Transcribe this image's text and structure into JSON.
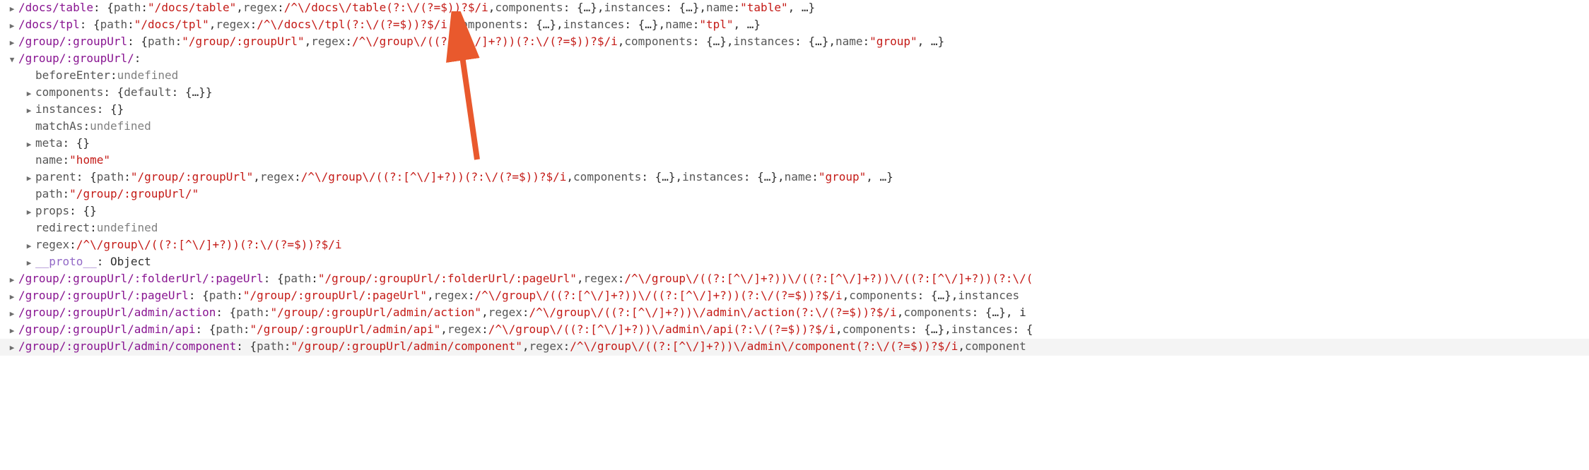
{
  "colors": {
    "key_purple": "#881491",
    "string_red": "#c41a16",
    "prop_grey": "#565656",
    "undefined_grey": "#808080",
    "proto_purple": "#9268c6"
  },
  "rows": [
    {
      "indent": 0,
      "expand": "closed",
      "key": "/docs/table",
      "keyClass": "k-path",
      "segs": [
        {
          "t": "punct",
          "v": ": {"
        },
        {
          "t": "k-prop",
          "v": "path"
        },
        {
          "t": "punct",
          "v": ": "
        },
        {
          "t": "str",
          "v": "\"/docs/table\""
        },
        {
          "t": "punct",
          "v": ", "
        },
        {
          "t": "k-prop",
          "v": "regex"
        },
        {
          "t": "punct",
          "v": ": "
        },
        {
          "t": "regex",
          "v": "/^\\/docs\\/table(?:\\/(?=$))?$/i"
        },
        {
          "t": "punct",
          "v": ", "
        },
        {
          "t": "k-prop",
          "v": "components"
        },
        {
          "t": "punct",
          "v": ": {…}, "
        },
        {
          "t": "k-prop",
          "v": "instances"
        },
        {
          "t": "punct",
          "v": ": {…}, "
        },
        {
          "t": "k-prop",
          "v": "name"
        },
        {
          "t": "punct",
          "v": ": "
        },
        {
          "t": "str",
          "v": "\"table\""
        },
        {
          "t": "punct",
          "v": ", …}"
        }
      ]
    },
    {
      "indent": 0,
      "expand": "closed",
      "key": "/docs/tpl",
      "keyClass": "k-path",
      "segs": [
        {
          "t": "punct",
          "v": ": {"
        },
        {
          "t": "k-prop",
          "v": "path"
        },
        {
          "t": "punct",
          "v": ": "
        },
        {
          "t": "str",
          "v": "\"/docs/tpl\""
        },
        {
          "t": "punct",
          "v": ", "
        },
        {
          "t": "k-prop",
          "v": "regex"
        },
        {
          "t": "punct",
          "v": ": "
        },
        {
          "t": "regex",
          "v": "/^\\/docs\\/tpl(?:\\/(?=$))?$/i"
        },
        {
          "t": "punct",
          "v": ", "
        },
        {
          "t": "k-prop",
          "v": "components"
        },
        {
          "t": "punct",
          "v": ": {…}, "
        },
        {
          "t": "k-prop",
          "v": "instances"
        },
        {
          "t": "punct",
          "v": ": {…}, "
        },
        {
          "t": "k-prop",
          "v": "name"
        },
        {
          "t": "punct",
          "v": ": "
        },
        {
          "t": "str",
          "v": "\"tpl\""
        },
        {
          "t": "punct",
          "v": ", …}"
        }
      ]
    },
    {
      "indent": 0,
      "expand": "closed",
      "key": "/group/:groupUrl",
      "keyClass": "k-path",
      "segs": [
        {
          "t": "punct",
          "v": ": {"
        },
        {
          "t": "k-prop",
          "v": "path"
        },
        {
          "t": "punct",
          "v": ": "
        },
        {
          "t": "str",
          "v": "\"/group/:groupUrl\""
        },
        {
          "t": "punct",
          "v": ", "
        },
        {
          "t": "k-prop",
          "v": "regex"
        },
        {
          "t": "punct",
          "v": ": "
        },
        {
          "t": "regex",
          "v": "/^\\/group\\/((?:[^\\/]+?))(?:\\/(?=$))?$/i"
        },
        {
          "t": "punct",
          "v": ", "
        },
        {
          "t": "k-prop",
          "v": "components"
        },
        {
          "t": "punct",
          "v": ": {…}, "
        },
        {
          "t": "k-prop",
          "v": "instances"
        },
        {
          "t": "punct",
          "v": ": {…}, "
        },
        {
          "t": "k-prop",
          "v": "name"
        },
        {
          "t": "punct",
          "v": ": "
        },
        {
          "t": "str",
          "v": "\"group\""
        },
        {
          "t": "punct",
          "v": ", …}"
        }
      ]
    },
    {
      "indent": 0,
      "expand": "open",
      "key": "/group/:groupUrl/",
      "keyClass": "k-path",
      "segs": [
        {
          "t": "punct",
          "v": ":"
        }
      ]
    },
    {
      "indent": 1,
      "expand": "none",
      "key": "beforeEnter",
      "keyClass": "k-prop",
      "segs": [
        {
          "t": "punct",
          "v": ": "
        },
        {
          "t": "undef",
          "v": "undefined"
        }
      ]
    },
    {
      "indent": 1,
      "expand": "closed",
      "key": "components",
      "keyClass": "k-prop",
      "segs": [
        {
          "t": "punct",
          "v": ": {"
        },
        {
          "t": "k-prop",
          "v": "default"
        },
        {
          "t": "punct",
          "v": ": {…}}"
        }
      ]
    },
    {
      "indent": 1,
      "expand": "closed",
      "key": "instances",
      "keyClass": "k-prop",
      "segs": [
        {
          "t": "punct",
          "v": ": {}"
        }
      ]
    },
    {
      "indent": 1,
      "expand": "none",
      "key": "matchAs",
      "keyClass": "k-prop",
      "segs": [
        {
          "t": "punct",
          "v": ": "
        },
        {
          "t": "undef",
          "v": "undefined"
        }
      ]
    },
    {
      "indent": 1,
      "expand": "closed",
      "key": "meta",
      "keyClass": "k-prop",
      "segs": [
        {
          "t": "punct",
          "v": ": {}"
        }
      ]
    },
    {
      "indent": 1,
      "expand": "none",
      "key": "name",
      "keyClass": "k-prop",
      "segs": [
        {
          "t": "punct",
          "v": ": "
        },
        {
          "t": "str",
          "v": "\"home\""
        }
      ]
    },
    {
      "indent": 1,
      "expand": "closed",
      "key": "parent",
      "keyClass": "k-prop",
      "segs": [
        {
          "t": "punct",
          "v": ": {"
        },
        {
          "t": "k-prop",
          "v": "path"
        },
        {
          "t": "punct",
          "v": ": "
        },
        {
          "t": "str",
          "v": "\"/group/:groupUrl\""
        },
        {
          "t": "punct",
          "v": ", "
        },
        {
          "t": "k-prop",
          "v": "regex"
        },
        {
          "t": "punct",
          "v": ": "
        },
        {
          "t": "regex",
          "v": "/^\\/group\\/((?:[^\\/]+?))(?:\\/(?=$))?$/i"
        },
        {
          "t": "punct",
          "v": ", "
        },
        {
          "t": "k-prop",
          "v": "components"
        },
        {
          "t": "punct",
          "v": ": {…}, "
        },
        {
          "t": "k-prop",
          "v": "instances"
        },
        {
          "t": "punct",
          "v": ": {…}, "
        },
        {
          "t": "k-prop",
          "v": "name"
        },
        {
          "t": "punct",
          "v": ": "
        },
        {
          "t": "str",
          "v": "\"group\""
        },
        {
          "t": "punct",
          "v": ", …}"
        }
      ]
    },
    {
      "indent": 1,
      "expand": "none",
      "key": "path",
      "keyClass": "k-prop",
      "segs": [
        {
          "t": "punct",
          "v": ": "
        },
        {
          "t": "str",
          "v": "\"/group/:groupUrl/\""
        }
      ]
    },
    {
      "indent": 1,
      "expand": "closed",
      "key": "props",
      "keyClass": "k-prop",
      "segs": [
        {
          "t": "punct",
          "v": ": {}"
        }
      ]
    },
    {
      "indent": 1,
      "expand": "none",
      "key": "redirect",
      "keyClass": "k-prop",
      "segs": [
        {
          "t": "punct",
          "v": ": "
        },
        {
          "t": "undef",
          "v": "undefined"
        }
      ]
    },
    {
      "indent": 1,
      "expand": "closed",
      "key": "regex",
      "keyClass": "k-prop",
      "segs": [
        {
          "t": "punct",
          "v": ": "
        },
        {
          "t": "regex",
          "v": "/^\\/group\\/((?:[^\\/]+?))(?:\\/(?=$))?$/i"
        }
      ]
    },
    {
      "indent": 1,
      "expand": "closed",
      "key": "__proto__",
      "keyClass": "proto",
      "segs": [
        {
          "t": "punct",
          "v": ": Object"
        }
      ]
    },
    {
      "indent": 0,
      "expand": "closed",
      "key": "/group/:groupUrl/:folderUrl/:pageUrl",
      "keyClass": "k-path",
      "segs": [
        {
          "t": "punct",
          "v": ": {"
        },
        {
          "t": "k-prop",
          "v": "path"
        },
        {
          "t": "punct",
          "v": ": "
        },
        {
          "t": "str",
          "v": "\"/group/:groupUrl/:folderUrl/:pageUrl\""
        },
        {
          "t": "punct",
          "v": ", "
        },
        {
          "t": "k-prop",
          "v": "regex"
        },
        {
          "t": "punct",
          "v": ": "
        },
        {
          "t": "regex",
          "v": "/^\\/group\\/((?:[^\\/]+?))\\/((?:[^\\/]+?))\\/((?:[^\\/]+?))(?:\\/("
        }
      ]
    },
    {
      "indent": 0,
      "expand": "closed",
      "key": "/group/:groupUrl/:pageUrl",
      "keyClass": "k-path",
      "segs": [
        {
          "t": "punct",
          "v": ": {"
        },
        {
          "t": "k-prop",
          "v": "path"
        },
        {
          "t": "punct",
          "v": ": "
        },
        {
          "t": "str",
          "v": "\"/group/:groupUrl/:pageUrl\""
        },
        {
          "t": "punct",
          "v": ", "
        },
        {
          "t": "k-prop",
          "v": "regex"
        },
        {
          "t": "punct",
          "v": ": "
        },
        {
          "t": "regex",
          "v": "/^\\/group\\/((?:[^\\/]+?))\\/((?:[^\\/]+?))(?:\\/(?=$))?$/i"
        },
        {
          "t": "punct",
          "v": ", "
        },
        {
          "t": "k-prop",
          "v": "components"
        },
        {
          "t": "punct",
          "v": ": {…}, "
        },
        {
          "t": "k-prop",
          "v": "instances"
        }
      ]
    },
    {
      "indent": 0,
      "expand": "closed",
      "key": "/group/:groupUrl/admin/action",
      "keyClass": "k-path",
      "segs": [
        {
          "t": "punct",
          "v": ": {"
        },
        {
          "t": "k-prop",
          "v": "path"
        },
        {
          "t": "punct",
          "v": ": "
        },
        {
          "t": "str",
          "v": "\"/group/:groupUrl/admin/action\""
        },
        {
          "t": "punct",
          "v": ", "
        },
        {
          "t": "k-prop",
          "v": "regex"
        },
        {
          "t": "punct",
          "v": ": "
        },
        {
          "t": "regex",
          "v": "/^\\/group\\/((?:[^\\/]+?))\\/admin\\/action(?:\\/(?=$))?$/i"
        },
        {
          "t": "punct",
          "v": ", "
        },
        {
          "t": "k-prop",
          "v": "components"
        },
        {
          "t": "punct",
          "v": ": {…}, i"
        }
      ]
    },
    {
      "indent": 0,
      "expand": "closed",
      "key": "/group/:groupUrl/admin/api",
      "keyClass": "k-path",
      "segs": [
        {
          "t": "punct",
          "v": ": {"
        },
        {
          "t": "k-prop",
          "v": "path"
        },
        {
          "t": "punct",
          "v": ": "
        },
        {
          "t": "str",
          "v": "\"/group/:groupUrl/admin/api\""
        },
        {
          "t": "punct",
          "v": ", "
        },
        {
          "t": "k-prop",
          "v": "regex"
        },
        {
          "t": "punct",
          "v": ": "
        },
        {
          "t": "regex",
          "v": "/^\\/group\\/((?:[^\\/]+?))\\/admin\\/api(?:\\/(?=$))?$/i"
        },
        {
          "t": "punct",
          "v": ", "
        },
        {
          "t": "k-prop",
          "v": "components"
        },
        {
          "t": "punct",
          "v": ": {…}, "
        },
        {
          "t": "k-prop",
          "v": "instances"
        },
        {
          "t": "punct",
          "v": ": {"
        }
      ]
    },
    {
      "indent": 0,
      "expand": "closed",
      "highlight": true,
      "key": "/group/:groupUrl/admin/component",
      "keyClass": "k-path",
      "segs": [
        {
          "t": "punct",
          "v": ": {"
        },
        {
          "t": "k-prop",
          "v": "path"
        },
        {
          "t": "punct",
          "v": ": "
        },
        {
          "t": "str",
          "v": "\"/group/:groupUrl/admin/component\""
        },
        {
          "t": "punct",
          "v": ", "
        },
        {
          "t": "k-prop",
          "v": "regex"
        },
        {
          "t": "punct",
          "v": ": "
        },
        {
          "t": "regex",
          "v": "/^\\/group\\/((?:[^\\/]+?))\\/admin\\/component(?:\\/(?=$))?$/i"
        },
        {
          "t": "punct",
          "v": ", "
        },
        {
          "t": "k-prop",
          "v": "component"
        }
      ]
    }
  ]
}
